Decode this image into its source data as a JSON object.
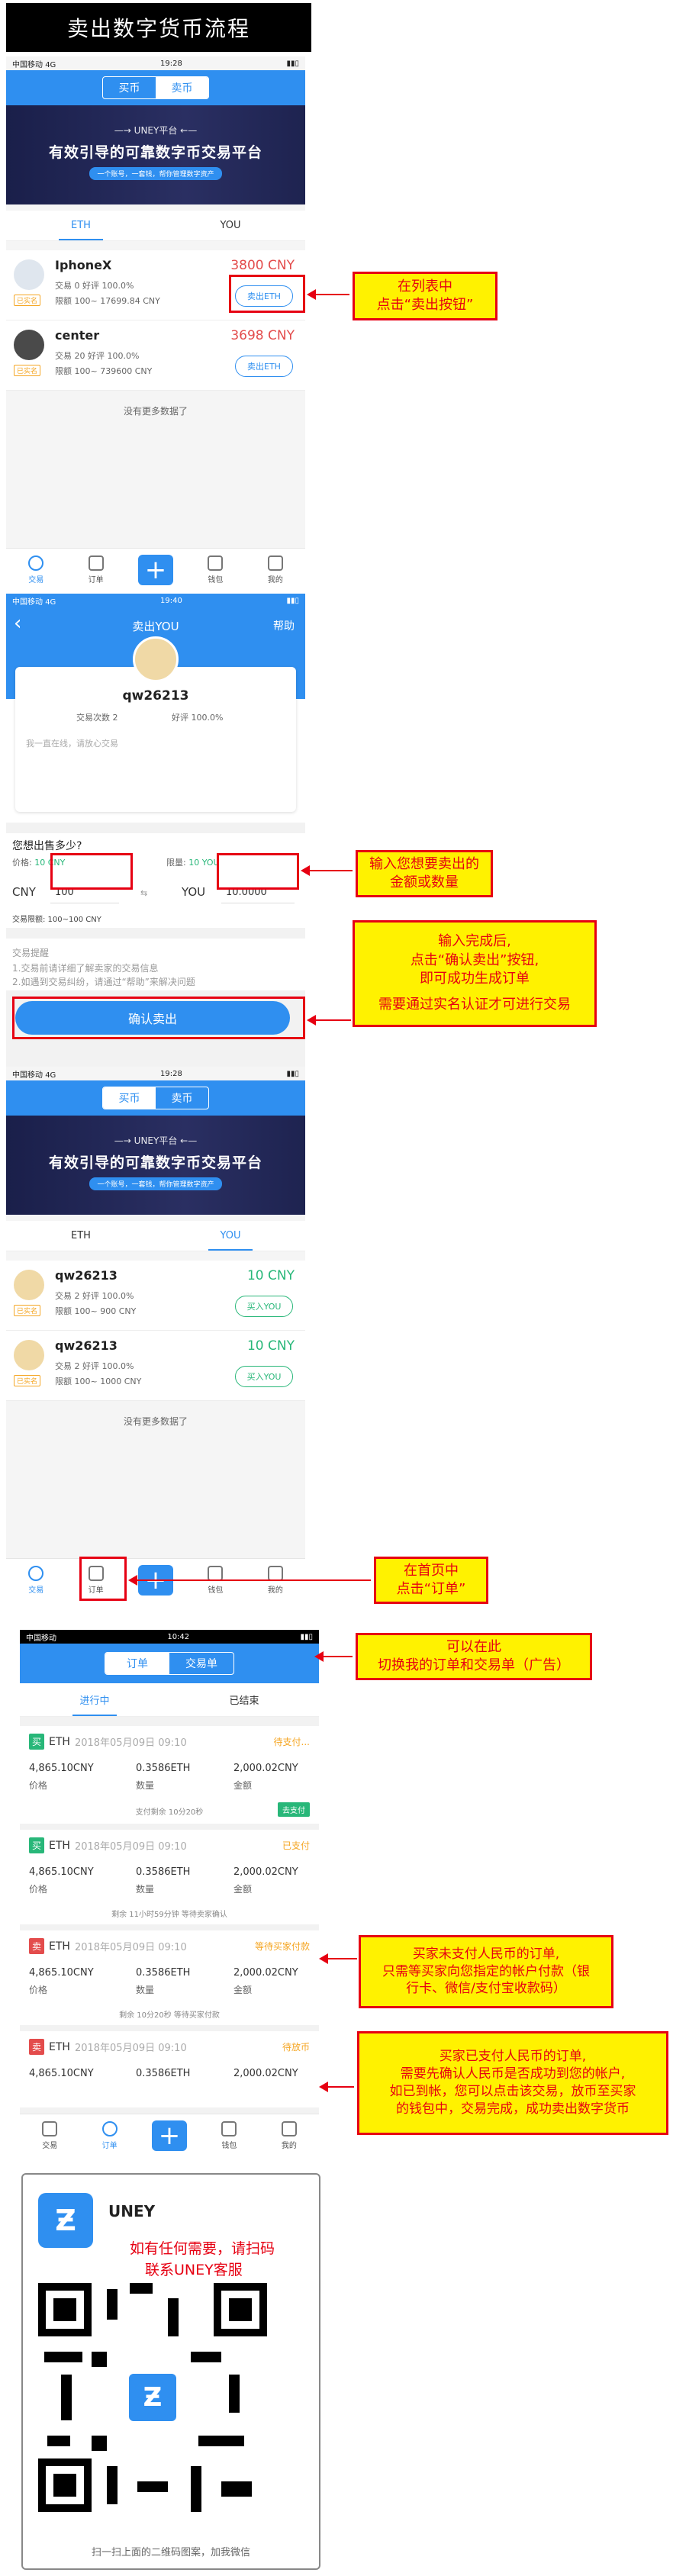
{
  "page_title": "卖出数字货币流程",
  "colors": {
    "accent": "#2f8ff0",
    "sell_red": "#e34c4c",
    "buy_green": "#28b779",
    "note_bg": "#fff200",
    "note_border": "#e60012"
  },
  "screen1": {
    "status": {
      "carrier": "中国移动",
      "net": "4G",
      "time": "19:28"
    },
    "segment": {
      "buy": "买币",
      "sell": "卖币"
    },
    "banner": {
      "small": "UNEY平台",
      "big": "有效引导的可靠数字币交易平台",
      "pill": "一个账号，一套钱，帮你管理数字资产"
    },
    "tabs": [
      "ETH",
      "YOU"
    ],
    "rows": [
      {
        "name": "IphoneX",
        "stats": "交易 0  好评 100.0%",
        "limit": "限额 100~ 17699.84 CNY",
        "badge": "已实名",
        "price": "3800 CNY",
        "button": "卖出ETH"
      },
      {
        "name": "center",
        "stats": "交易 20  好评 100.0%",
        "limit": "限额 100~ 739600 CNY",
        "badge": "已实名",
        "price": "3698 CNY",
        "button": "卖出ETH"
      }
    ],
    "no_more": "没有更多数据了",
    "nav": [
      "交易",
      "订单",
      "+",
      "钱包",
      "我的"
    ]
  },
  "note1": {
    "line1": "在列表中",
    "line2": "点击“卖出按钮”"
  },
  "screen2": {
    "status": {
      "carrier": "中国移动",
      "net": "4G",
      "time": "19:40"
    },
    "header": {
      "back": "‹",
      "title": "卖出YOU",
      "help": "帮助"
    },
    "user": {
      "name": "qw26213",
      "trades": "交易次数 2",
      "rating": "好评 100.0%"
    },
    "note_placeholder": "我一直在线，请放心交易",
    "question": "您想出售多少?",
    "price_label": "价格:",
    "price_value": "10 CNY",
    "limit_label": "限量:",
    "limit_value": "10 YOU",
    "cny_label": "CNY",
    "cny_value": "100",
    "you_label": "YOU",
    "you_value": "10.0000",
    "trade_limit": "交易限额: 100~100 CNY",
    "tips_title": "交易提醒",
    "tips": [
      "1.交易前请详细了解卖家的交易信息",
      "2.如遇到交易纠纷，请通过“帮助”来解决问题"
    ],
    "confirm": "确认卖出"
  },
  "note2": {
    "line1": "输入您想要卖出的",
    "line2": "金额或数量"
  },
  "note3": {
    "line1": "输入完成后,",
    "line2": "点击“确认卖出”按钮,",
    "line3": "即可成功生成订单",
    "line4": "需要通过实名认证才可进行交易"
  },
  "screen3": {
    "status": {
      "carrier": "中国移动",
      "net": "4G",
      "time": "19:28"
    },
    "segment": {
      "buy": "买币",
      "sell": "卖币"
    },
    "banner": {
      "small": "UNEY平台",
      "big": "有效引导的可靠数字币交易平台",
      "pill": "一个账号，一套钱，帮你管理数字资产"
    },
    "tabs": [
      "ETH",
      "YOU"
    ],
    "rows": [
      {
        "name": "qw26213",
        "stats": "交易 2  好评 100.0%",
        "limit": "限额 100~ 900 CNY",
        "badge": "已实名",
        "price": "10 CNY",
        "button": "买入YOU"
      },
      {
        "name": "qw26213",
        "stats": "交易 2  好评 100.0%",
        "limit": "限额 100~ 1000 CNY",
        "badge": "已实名",
        "price": "10 CNY",
        "button": "买入YOU"
      }
    ],
    "no_more": "没有更多数据了",
    "nav": [
      "交易",
      "订单",
      "+",
      "钱包",
      "我的"
    ]
  },
  "note4": {
    "line1": "在首页中",
    "line2": "点击“订单”"
  },
  "screen4": {
    "status": {
      "carrier": "中国移动",
      "time": "10:42"
    },
    "seg": {
      "a": "订单",
      "b": "交易单"
    },
    "subtabs": [
      "进行中",
      "已结束"
    ],
    "orders": [
      {
        "type": "买",
        "coin": "ETH",
        "date": "2018年05月09日 09:10",
        "status": "待支付...",
        "price": "4,865.10CNY",
        "price_l": "价格",
        "qty": "0.3586ETH",
        "qty_l": "数量",
        "amount": "2,000.02CNY",
        "amount_l": "金额",
        "foot": "支付剩余 10分20秒",
        "action": "去支付"
      },
      {
        "type": "买",
        "coin": "ETH",
        "date": "2018年05月09日 09:10",
        "status": "已支付",
        "price": "4,865.10CNY",
        "price_l": "价格",
        "qty": "0.3586ETH",
        "qty_l": "数量",
        "amount": "2,000.02CNY",
        "amount_l": "金额",
        "foot": "剩余 11小时59分钟 等待卖家确认"
      },
      {
        "type": "卖",
        "coin": "ETH",
        "date": "2018年05月09日 09:10",
        "status": "等待买家付款",
        "price": "4,865.10CNY",
        "price_l": "价格",
        "qty": "0.3586ETH",
        "qty_l": "数量",
        "amount": "2,000.02CNY",
        "amount_l": "金额",
        "foot": "剩余 10分20秒 等待买家付款"
      },
      {
        "type": "卖",
        "coin": "ETH",
        "date": "2018年05月09日 09:10",
        "status": "待放币",
        "price": "4,865.10CNY",
        "qty": "0.3586ETH",
        "amount": "2,000.02CNY"
      }
    ],
    "nav": [
      "交易",
      "订单",
      "+",
      "钱包",
      "我的"
    ]
  },
  "note5": {
    "line1": "可以在此",
    "line2": "切换我的订单和交易单（广告）"
  },
  "note6": {
    "line1": "买家未支付人民币的订单,",
    "line2": "只需等买家向您指定的帐户付款（银",
    "line3": "行卡、微信/支付宝收款码）"
  },
  "note7": {
    "line1": "买家已支付人民币的订单,",
    "line2": "需要先确认人民币是否成功到您的帐户,",
    "line3": "如已到帐，您可以点击该交易，放币至买家",
    "line4": "的钱包中，交易完成，成功卖出数字货币"
  },
  "qr_card": {
    "brand": "UNEY",
    "line1": "如有任何需要，请扫码",
    "line2": "联系UNEY客服",
    "caption": "扫一扫上面的二维码图案，加我微信"
  }
}
